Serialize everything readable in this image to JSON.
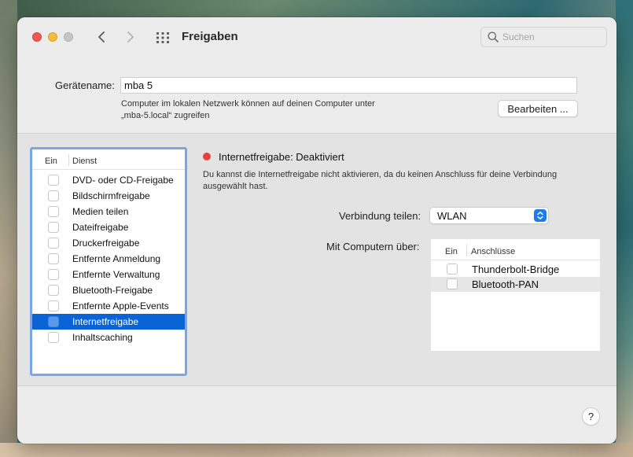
{
  "window": {
    "title": "Freigaben"
  },
  "toolbar": {
    "search_placeholder": "Suchen",
    "search_value": ""
  },
  "device": {
    "label": "Gerätename:",
    "name": "mba 5",
    "note_line1": "Computer im lokalen Netzwerk können auf deinen Computer unter",
    "note_line2": "„mba-5.local“ zugreifen",
    "edit_label": "Bearbeiten ..."
  },
  "services": {
    "header_on": "Ein",
    "header_service": "Dienst",
    "items": [
      {
        "label": "DVD- oder CD-Freigabe",
        "checked": false,
        "selected": false
      },
      {
        "label": "Bildschirmfreigabe",
        "checked": false,
        "selected": false
      },
      {
        "label": "Medien teilen",
        "checked": false,
        "selected": false
      },
      {
        "label": "Dateifreigabe",
        "checked": false,
        "selected": false
      },
      {
        "label": "Druckerfreigabe",
        "checked": false,
        "selected": false
      },
      {
        "label": "Entfernte Anmeldung",
        "checked": false,
        "selected": false
      },
      {
        "label": "Entfernte Verwaltung",
        "checked": false,
        "selected": false
      },
      {
        "label": "Bluetooth-Freigabe",
        "checked": false,
        "selected": false
      },
      {
        "label": "Entfernte Apple-Events",
        "checked": false,
        "selected": false
      },
      {
        "label": "Internetfreigabe",
        "checked": false,
        "selected": true
      },
      {
        "label": "Inhaltscaching",
        "checked": false,
        "selected": false
      }
    ]
  },
  "detail": {
    "status_color": "#e8403a",
    "status_text": "Internetfreigabe: Deaktiviert",
    "description_line1": "Du kannst die Internetfreigabe nicht aktivieren, da du keinen Anschluss für deine Verbindung",
    "description_line2": "ausgewählt hast.",
    "share_label": "Verbindung teilen:",
    "share_value": "WLAN",
    "via_label": "Mit Computern über:",
    "ports_header_on": "Ein",
    "ports_header_ports": "Anschlüsse",
    "ports": [
      {
        "label": "Thunderbolt-Bridge",
        "checked": false
      },
      {
        "label": "Bluetooth-PAN",
        "checked": false
      }
    ]
  },
  "help": {
    "label": "?"
  },
  "colors": {
    "accent": "#0a64d8",
    "list_focus_ring": "#7aa6e8",
    "select_arrow": "#1a7bf2"
  }
}
